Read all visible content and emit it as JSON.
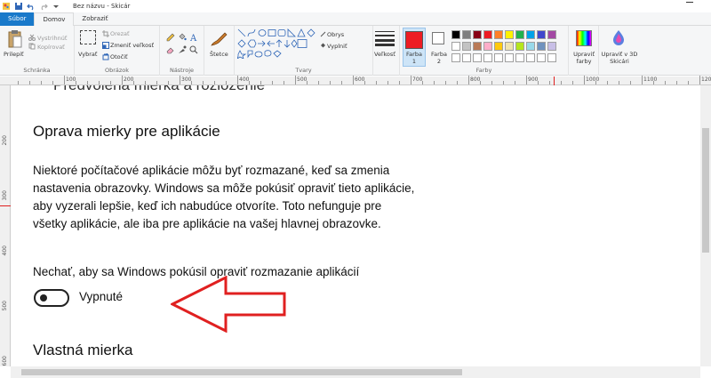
{
  "window": {
    "title": "Bez názvu - Skicár"
  },
  "tabs": [
    {
      "label": "Súbor"
    },
    {
      "label": "Domov"
    },
    {
      "label": "Zobraziť"
    }
  ],
  "ribbon": {
    "clipboard": {
      "paste": "Prilepiť",
      "cut": "Vystrihnúť",
      "copy": "Kopírovať",
      "group": "Schránka"
    },
    "image": {
      "select": "Vybrať",
      "crop": "Orezať",
      "resize": "Zmeniť veľkosť",
      "rotate": "Otočiť",
      "group": "Obrázok"
    },
    "tools": {
      "group": "Nástroje"
    },
    "brushes": {
      "label": "Štetce"
    },
    "shapes": {
      "outline": "Obrys",
      "fill": "Vyplniť",
      "group": "Tvary"
    },
    "size": {
      "label": "Veľkosť"
    },
    "colors": {
      "color1": "Farba 1",
      "color2": "Farba 2",
      "edit": "Upraviť farby",
      "group": "Farby",
      "color1_value": "#ed1c24",
      "color2_value": "#ffffff",
      "palette_row1": [
        "#000000",
        "#7f7f7f",
        "#880015",
        "#ed1c24",
        "#ff7f27",
        "#fff200",
        "#22b14c",
        "#00a2e8",
        "#3f48cc",
        "#a349a4"
      ],
      "palette_row2": [
        "#ffffff",
        "#c3c3c3",
        "#b97a57",
        "#ffaec9",
        "#ffc90e",
        "#efe4b0",
        "#b5e61d",
        "#99d9ea",
        "#7092be",
        "#c8bfe7"
      ]
    },
    "paint3d": "Upraviť v 3D Skicári"
  },
  "ruler": {
    "h": [
      "100",
      "200",
      "300",
      "400",
      "500",
      "600",
      "700",
      "800",
      "900",
      "1000",
      "1100",
      "1200"
    ],
    "v": [
      "200",
      "300",
      "400",
      "500",
      "600"
    ]
  },
  "canvas": {
    "cut_heading": "Predvolená mierka a rozloženie",
    "heading": "Oprava mierky pre aplikácie",
    "paragraph": "Niektoré počítačové aplikácie môžu byť rozmazané, keď sa zmenia nastavenia obrazovky. Windows sa môže pokúsiť opraviť tieto aplikácie, aby vyzerali lepšie, keď ich nabudúce otvoríte. Toto nefunguje pre všetky aplikácie, ale iba pre aplikácie na vašej hlavnej obrazovke.",
    "toggle_label": "Nechať, aby sa Windows pokúsil opraviť rozmazanie aplikácií",
    "toggle_state": "Vypnuté",
    "toggle_on": false,
    "heading2": "Vlastná mierka",
    "arrow_color": "#e02020"
  }
}
